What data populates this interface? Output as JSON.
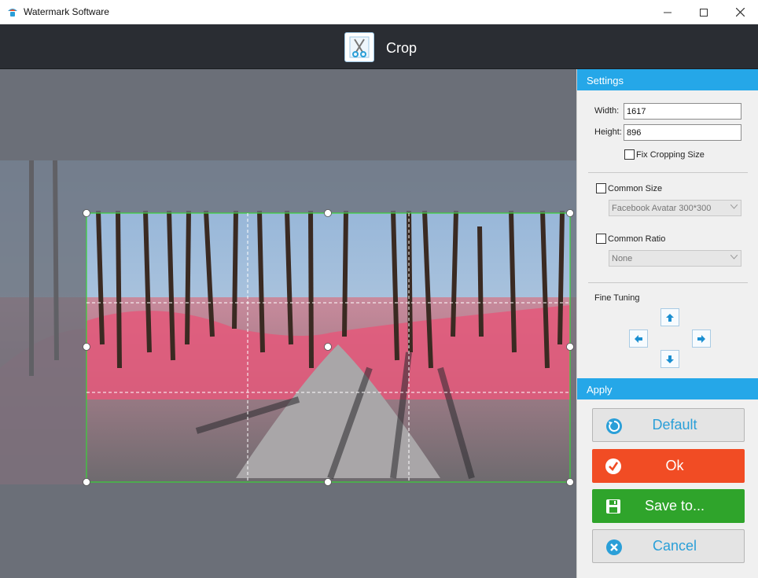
{
  "window": {
    "title": "Watermark Software"
  },
  "header": {
    "title": "Crop",
    "icon": "scissors-icon"
  },
  "settings": {
    "section_title": "Settings",
    "width_label": "Width:",
    "width_value": "1617",
    "height_label": "Height:",
    "height_value": "896",
    "fix_size_label": "Fix Cropping Size",
    "fix_size_checked": false,
    "common_size_label": "Common Size",
    "common_size_checked": false,
    "common_size_value": "Facebook Avatar 300*300",
    "common_ratio_label": "Common Ratio",
    "common_ratio_checked": false,
    "common_ratio_value": "None",
    "fine_tuning_label": "Fine Tuning"
  },
  "apply": {
    "section_title": "Apply",
    "default_label": "Default",
    "ok_label": "Ok",
    "save_label": "Save to...",
    "cancel_label": "Cancel"
  },
  "colors": {
    "accent": "#25a7e8",
    "ok": "#f14c24",
    "save": "#2fa42b",
    "crop_border": "#39d339"
  }
}
